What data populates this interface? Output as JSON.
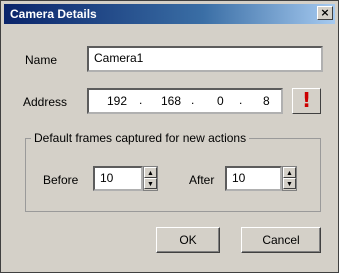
{
  "window": {
    "title": "Camera Details",
    "close_glyph": "×"
  },
  "name_field": {
    "label": "Name",
    "value": "Camera1"
  },
  "address_field": {
    "label": "Address",
    "octets": [
      "192",
      "168",
      "0",
      "8"
    ],
    "separator": ".",
    "warning_glyph": "!"
  },
  "frames_group": {
    "legend": "Default frames captured for new actions",
    "before": {
      "label": "Before",
      "value": "10"
    },
    "after": {
      "label": "After",
      "value": "10"
    }
  },
  "buttons": {
    "ok": "OK",
    "cancel": "Cancel"
  },
  "icons": {
    "close": "close-icon",
    "warning": "warning-icon",
    "spin_up": "spin-up-icon",
    "spin_down": "spin-down-icon"
  },
  "colors": {
    "title_start": "#0a246a",
    "title_end": "#a6caf0",
    "warning": "#cc0000",
    "dialog_face": "#d4d0c8"
  }
}
